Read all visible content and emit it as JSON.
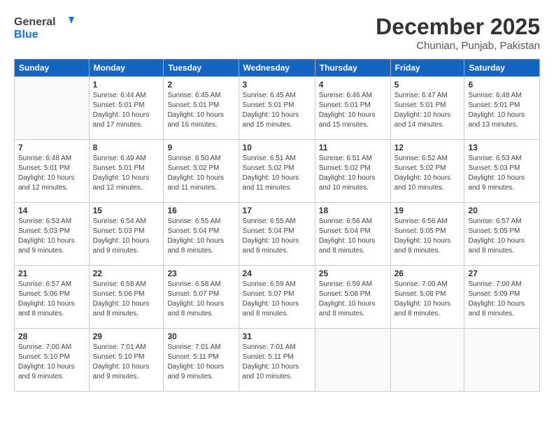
{
  "header": {
    "logo_general": "General",
    "logo_blue": "Blue",
    "month_title": "December 2025",
    "location": "Chunian, Punjab, Pakistan"
  },
  "calendar": {
    "days_header": [
      "Sunday",
      "Monday",
      "Tuesday",
      "Wednesday",
      "Thursday",
      "Friday",
      "Saturday"
    ],
    "weeks": [
      [
        {
          "day": "",
          "info": ""
        },
        {
          "day": "1",
          "info": "Sunrise: 6:44 AM\nSunset: 5:01 PM\nDaylight: 10 hours\nand 17 minutes."
        },
        {
          "day": "2",
          "info": "Sunrise: 6:45 AM\nSunset: 5:01 PM\nDaylight: 10 hours\nand 16 minutes."
        },
        {
          "day": "3",
          "info": "Sunrise: 6:45 AM\nSunset: 5:01 PM\nDaylight: 10 hours\nand 15 minutes."
        },
        {
          "day": "4",
          "info": "Sunrise: 6:46 AM\nSunset: 5:01 PM\nDaylight: 10 hours\nand 15 minutes."
        },
        {
          "day": "5",
          "info": "Sunrise: 6:47 AM\nSunset: 5:01 PM\nDaylight: 10 hours\nand 14 minutes."
        },
        {
          "day": "6",
          "info": "Sunrise: 6:48 AM\nSunset: 5:01 PM\nDaylight: 10 hours\nand 13 minutes."
        }
      ],
      [
        {
          "day": "7",
          "info": "Sunrise: 6:48 AM\nSunset: 5:01 PM\nDaylight: 10 hours\nand 12 minutes."
        },
        {
          "day": "8",
          "info": "Sunrise: 6:49 AM\nSunset: 5:01 PM\nDaylight: 10 hours\nand 12 minutes."
        },
        {
          "day": "9",
          "info": "Sunrise: 6:50 AM\nSunset: 5:02 PM\nDaylight: 10 hours\nand 11 minutes."
        },
        {
          "day": "10",
          "info": "Sunrise: 6:51 AM\nSunset: 5:02 PM\nDaylight: 10 hours\nand 11 minutes."
        },
        {
          "day": "11",
          "info": "Sunrise: 6:51 AM\nSunset: 5:02 PM\nDaylight: 10 hours\nand 10 minutes."
        },
        {
          "day": "12",
          "info": "Sunrise: 6:52 AM\nSunset: 5:02 PM\nDaylight: 10 hours\nand 10 minutes."
        },
        {
          "day": "13",
          "info": "Sunrise: 6:53 AM\nSunset: 5:03 PM\nDaylight: 10 hours\nand 9 minutes."
        }
      ],
      [
        {
          "day": "14",
          "info": "Sunrise: 6:53 AM\nSunset: 5:03 PM\nDaylight: 10 hours\nand 9 minutes."
        },
        {
          "day": "15",
          "info": "Sunrise: 6:54 AM\nSunset: 5:03 PM\nDaylight: 10 hours\nand 9 minutes."
        },
        {
          "day": "16",
          "info": "Sunrise: 6:55 AM\nSunset: 5:04 PM\nDaylight: 10 hours\nand 8 minutes."
        },
        {
          "day": "17",
          "info": "Sunrise: 6:55 AM\nSunset: 5:04 PM\nDaylight: 10 hours\nand 8 minutes."
        },
        {
          "day": "18",
          "info": "Sunrise: 6:56 AM\nSunset: 5:04 PM\nDaylight: 10 hours\nand 8 minutes."
        },
        {
          "day": "19",
          "info": "Sunrise: 6:56 AM\nSunset: 5:05 PM\nDaylight: 10 hours\nand 8 minutes."
        },
        {
          "day": "20",
          "info": "Sunrise: 6:57 AM\nSunset: 5:05 PM\nDaylight: 10 hours\nand 8 minutes."
        }
      ],
      [
        {
          "day": "21",
          "info": "Sunrise: 6:57 AM\nSunset: 5:06 PM\nDaylight: 10 hours\nand 8 minutes."
        },
        {
          "day": "22",
          "info": "Sunrise: 6:58 AM\nSunset: 5:06 PM\nDaylight: 10 hours\nand 8 minutes."
        },
        {
          "day": "23",
          "info": "Sunrise: 6:58 AM\nSunset: 5:07 PM\nDaylight: 10 hours\nand 8 minutes."
        },
        {
          "day": "24",
          "info": "Sunrise: 6:59 AM\nSunset: 5:07 PM\nDaylight: 10 hours\nand 8 minutes."
        },
        {
          "day": "25",
          "info": "Sunrise: 6:59 AM\nSunset: 5:08 PM\nDaylight: 10 hours\nand 8 minutes."
        },
        {
          "day": "26",
          "info": "Sunrise: 7:00 AM\nSunset: 5:08 PM\nDaylight: 10 hours\nand 8 minutes."
        },
        {
          "day": "27",
          "info": "Sunrise: 7:00 AM\nSunset: 5:09 PM\nDaylight: 10 hours\nand 8 minutes."
        }
      ],
      [
        {
          "day": "28",
          "info": "Sunrise: 7:00 AM\nSunset: 5:10 PM\nDaylight: 10 hours\nand 9 minutes."
        },
        {
          "day": "29",
          "info": "Sunrise: 7:01 AM\nSunset: 5:10 PM\nDaylight: 10 hours\nand 9 minutes."
        },
        {
          "day": "30",
          "info": "Sunrise: 7:01 AM\nSunset: 5:11 PM\nDaylight: 10 hours\nand 9 minutes."
        },
        {
          "day": "31",
          "info": "Sunrise: 7:01 AM\nSunset: 5:11 PM\nDaylight: 10 hours\nand 10 minutes."
        },
        {
          "day": "",
          "info": ""
        },
        {
          "day": "",
          "info": ""
        },
        {
          "day": "",
          "info": ""
        }
      ]
    ]
  }
}
